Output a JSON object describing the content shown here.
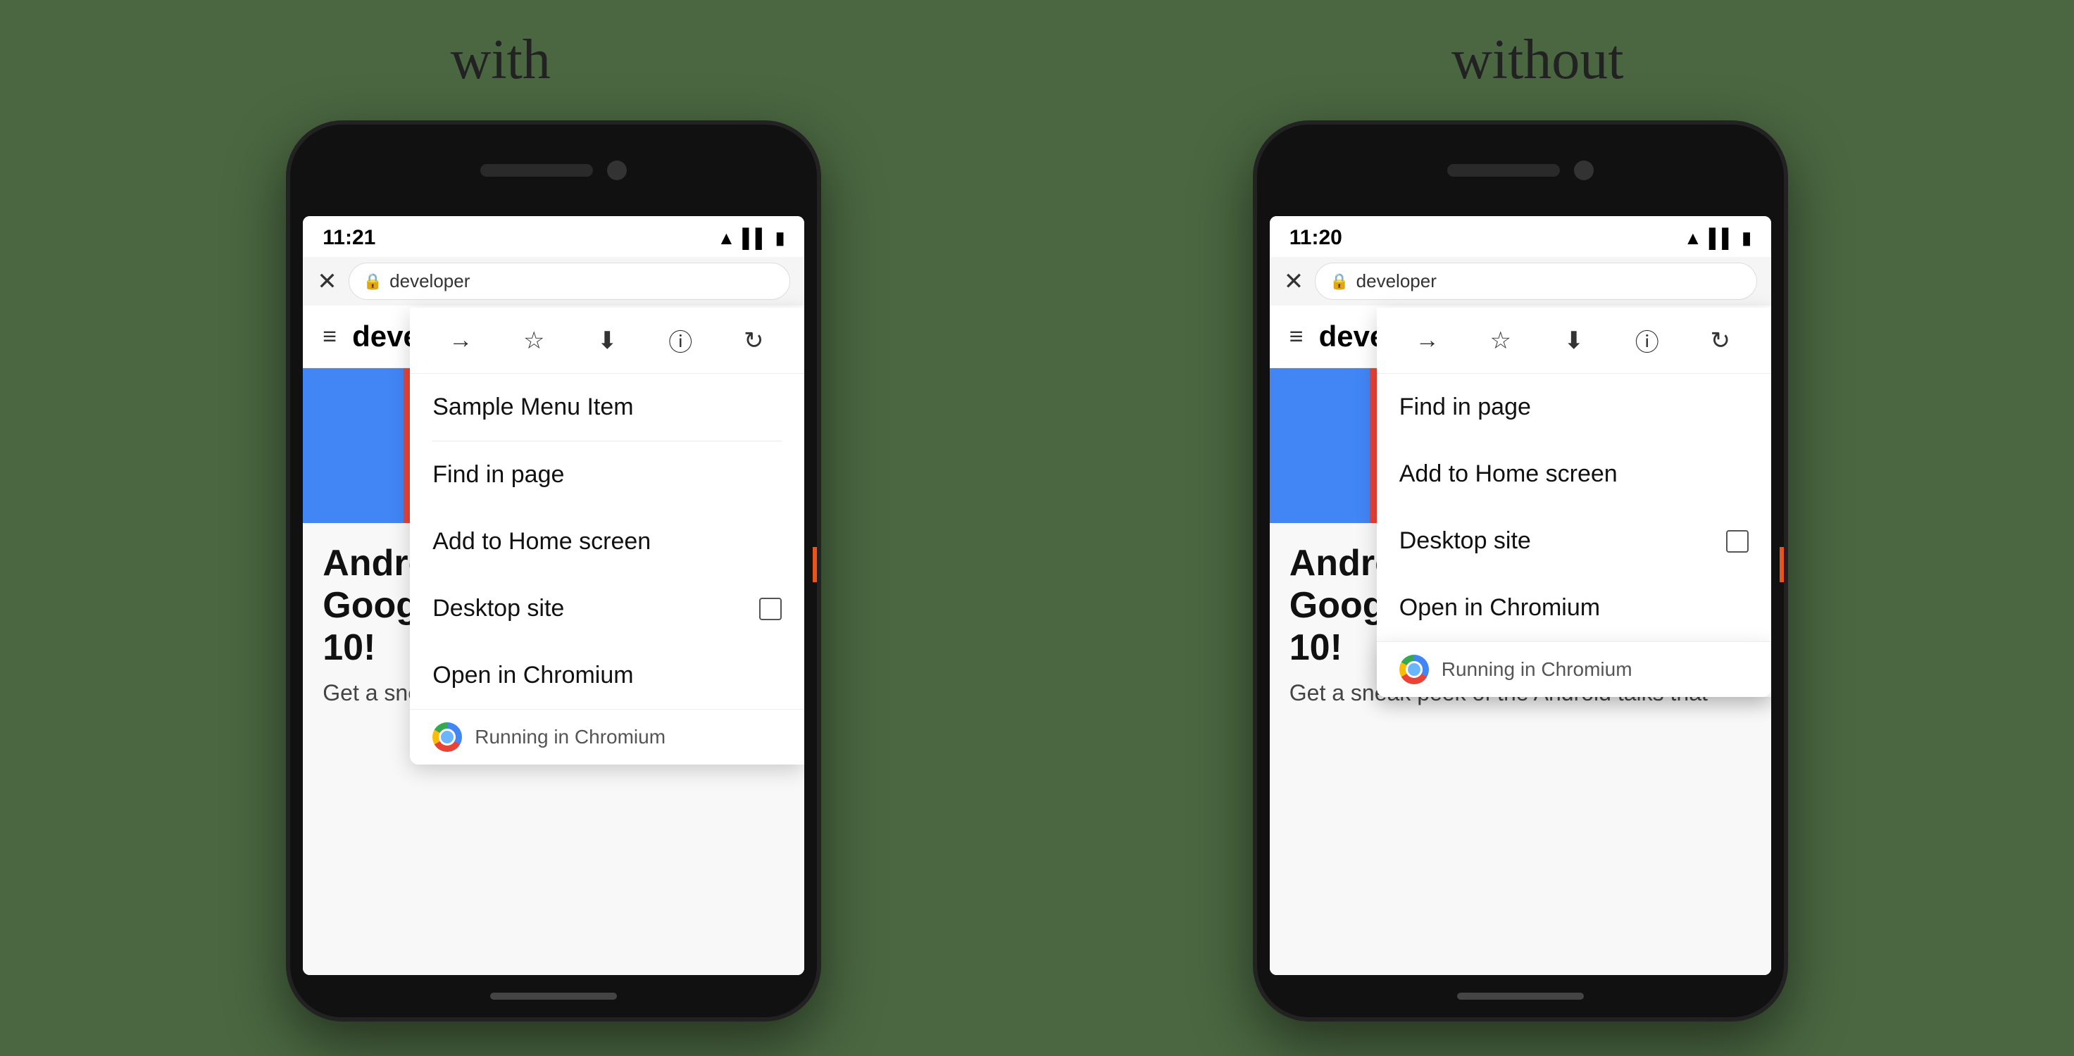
{
  "labels": {
    "with": "with",
    "without": "without"
  },
  "left_phone": {
    "status_time": "11:21",
    "url": "developer",
    "menu_items": [
      {
        "label": "Sample Menu Item",
        "has_divider": true
      },
      {
        "label": "Find in page",
        "has_divider": false
      },
      {
        "label": "Add to Home screen",
        "has_divider": false
      },
      {
        "label": "Desktop site",
        "has_checkbox": true,
        "has_divider": false
      },
      {
        "label": "Open in Chromium",
        "has_divider": false
      }
    ],
    "footer_text": "Running in Chromium",
    "page_heading_line1": "Andro",
    "page_heading_line2": "Googl",
    "page_heading_line3": "10!",
    "page_subtext": "Get a sneak peek of the Android talks that"
  },
  "right_phone": {
    "status_time": "11:20",
    "url": "developer",
    "menu_items": [
      {
        "label": "Find in page",
        "has_divider": false
      },
      {
        "label": "Add to Home screen",
        "has_divider": false
      },
      {
        "label": "Desktop site",
        "has_checkbox": true,
        "has_divider": false
      },
      {
        "label": "Open in Chromium",
        "has_divider": false
      }
    ],
    "footer_text": "Running in Chromium",
    "page_heading_line1": "Andro",
    "page_heading_line2": "Googl",
    "page_heading_line3": "10!",
    "page_subtext": "Get a sneak peek of the Android talks that"
  },
  "nav_label": "develop",
  "color_strips": [
    "#4285f4",
    "#ea4335",
    "#fbbc05",
    "#34a853",
    "#111"
  ],
  "icons": {
    "forward": "→",
    "star": "☆",
    "download": "⬇",
    "info": "ⓘ",
    "refresh": "↻",
    "close": "✕",
    "lock": "🔒",
    "menu": "≡"
  }
}
